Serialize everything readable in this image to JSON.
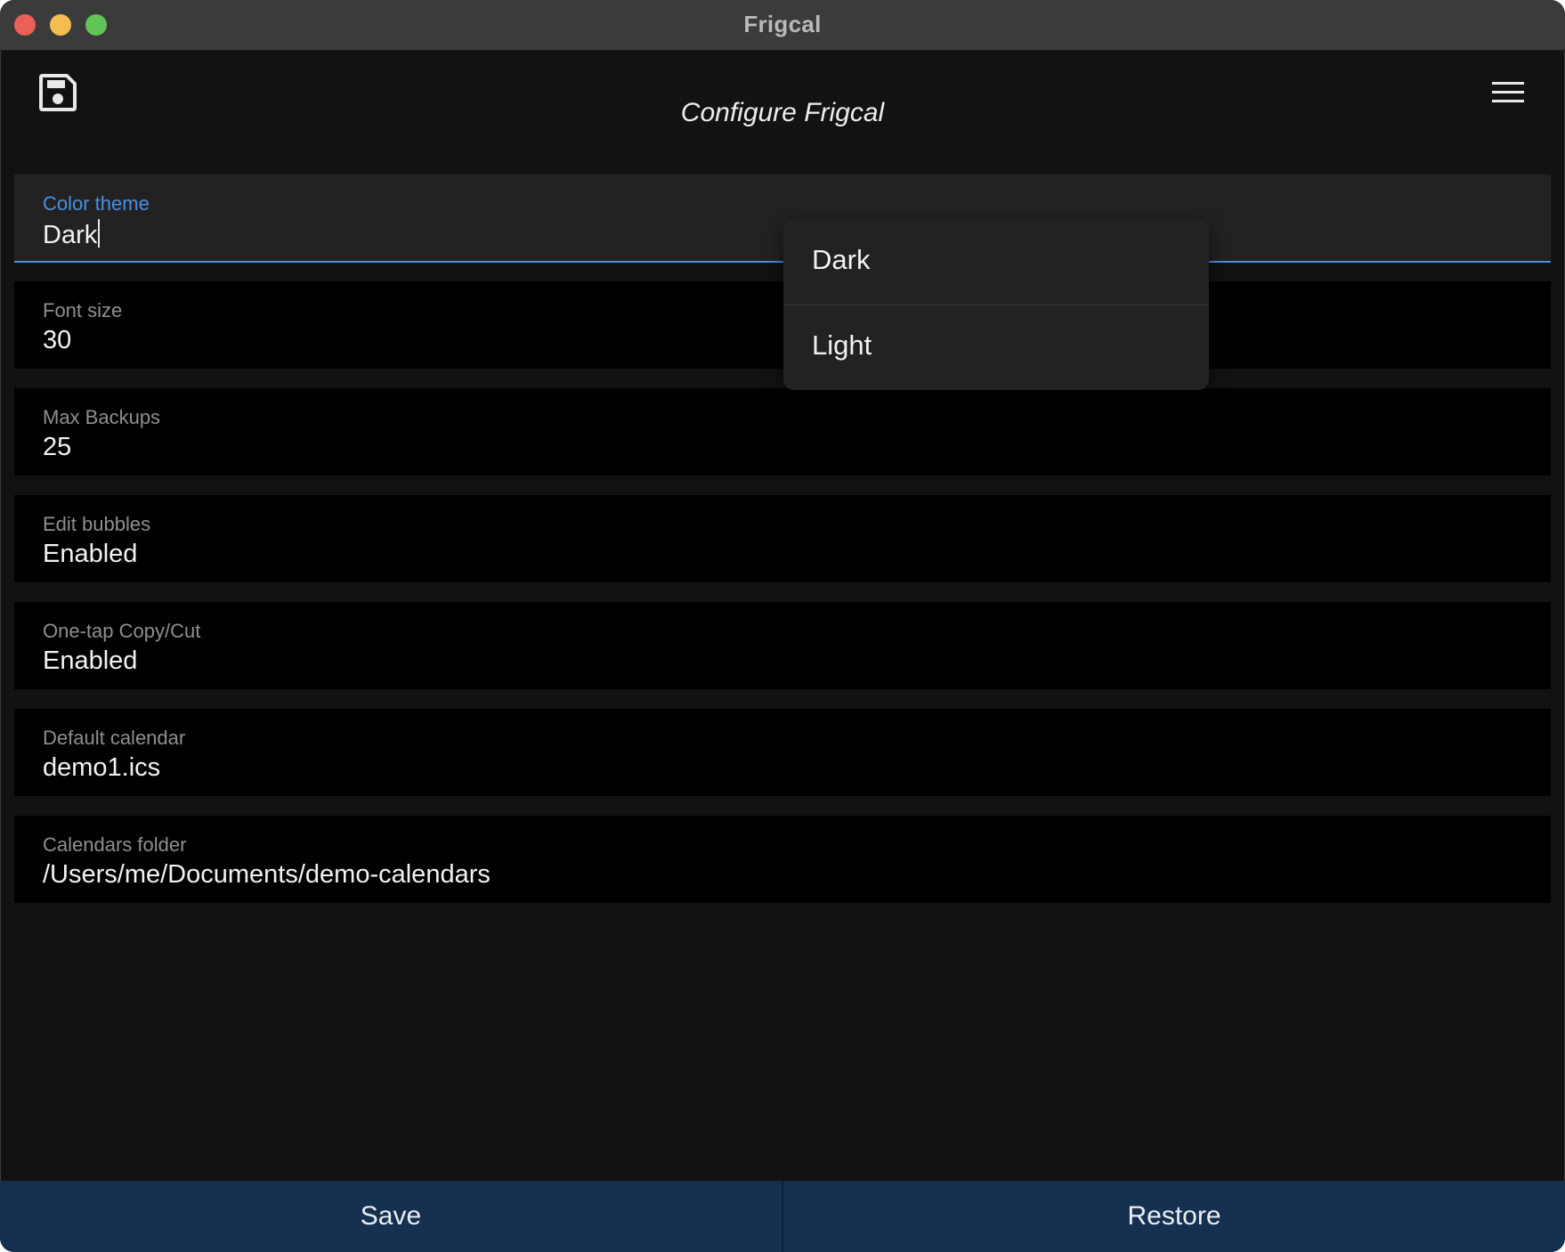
{
  "window": {
    "title": "Frigcal"
  },
  "header": {
    "title": "Configure Frigcal",
    "save_icon": "floppy-disk-icon",
    "menu_icon": "hamburger-menu-icon"
  },
  "fields": [
    {
      "label": "Color theme",
      "value": "Dark"
    },
    {
      "label": "Font size",
      "value": "30"
    },
    {
      "label": "Max Backups",
      "value": "25"
    },
    {
      "label": "Edit bubbles",
      "value": "Enabled"
    },
    {
      "label": "One-tap Copy/Cut",
      "value": "Enabled"
    },
    {
      "label": "Default calendar",
      "value": "demo1.ics"
    },
    {
      "label": "Calendars folder",
      "value": "/Users/me/Documents/demo-calendars"
    }
  ],
  "dropdown": {
    "options": [
      "Dark",
      "Light"
    ]
  },
  "footer": {
    "save_label": "Save",
    "restore_label": "Restore"
  },
  "colors": {
    "accent": "#4a90e2",
    "background": "#121212",
    "button_bar": "#16304f"
  }
}
